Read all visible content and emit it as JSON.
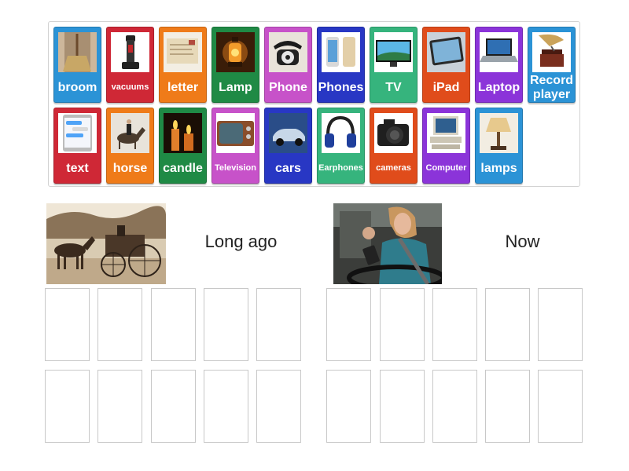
{
  "cards": [
    {
      "label": "broom",
      "color": "#2b93d6",
      "icon": "broom-icon"
    },
    {
      "label": "vacuums",
      "color": "#cf2836",
      "icon": "vacuum-icon"
    },
    {
      "label": "letter",
      "color": "#ef7b19",
      "icon": "letter-icon"
    },
    {
      "label": "Lamp",
      "color": "#1f8a45",
      "icon": "oil-lamp-icon"
    },
    {
      "label": "Phone",
      "color": "#c752c9",
      "icon": "rotary-phone-icon"
    },
    {
      "label": "Phones",
      "color": "#2837c4",
      "icon": "smartphones-icon"
    },
    {
      "label": "TV",
      "color": "#36b47d",
      "icon": "tv-icon"
    },
    {
      "label": "iPad",
      "color": "#e04c1b",
      "icon": "tablet-icon"
    },
    {
      "label": "Laptop",
      "color": "#8b34d9",
      "icon": "laptop-icon"
    },
    {
      "label": "Record player",
      "color": "#2b93d6",
      "icon": "gramophone-icon"
    },
    {
      "label": "text",
      "color": "#cf2836",
      "icon": "text-message-icon"
    },
    {
      "label": "horse",
      "color": "#ef7b19",
      "icon": "horse-icon"
    },
    {
      "label": "candle",
      "color": "#1f8a45",
      "icon": "candle-icon"
    },
    {
      "label": "Television",
      "color": "#c752c9",
      "icon": "retro-tv-icon"
    },
    {
      "label": "cars",
      "color": "#2837c4",
      "icon": "car-icon"
    },
    {
      "label": "Earphones",
      "color": "#36b47d",
      "icon": "headphones-icon"
    },
    {
      "label": "cameras",
      "color": "#e04c1b",
      "icon": "camera-icon"
    },
    {
      "label": "Computer",
      "color": "#8b34d9",
      "icon": "computer-icon"
    },
    {
      "label": "lamps",
      "color": "#2b93d6",
      "icon": "table-lamp-icon"
    }
  ],
  "groups": {
    "long_ago": {
      "heading": "Long ago",
      "photo": "horse-carriage-photo"
    },
    "now": {
      "heading": "Now",
      "photo": "driver-texting-photo"
    }
  }
}
